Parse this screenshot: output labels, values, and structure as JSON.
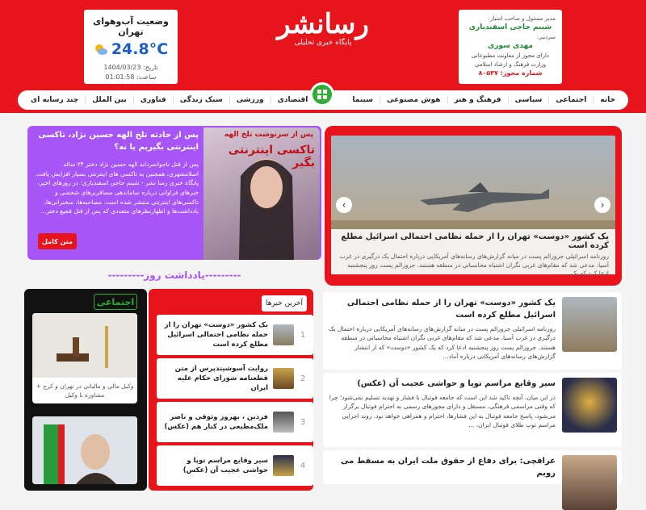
{
  "weather": {
    "title": "وضعیت آب‌وهوای تهران",
    "temp": "24.8°C",
    "date": "تاریخ: 1404/03/23",
    "time": "ساعت: 01:01:58"
  },
  "logo": {
    "wordmark": "رسانشر",
    "tagline": "پایگاه خبری تحلیلی"
  },
  "license": {
    "owner_label": "مدیر مسئول و صاحب امتیاز:",
    "owner_name": "شبنم حاجی اسفندیاری",
    "editor_label": "سردبیر:",
    "editor_name": "مهدی سوری",
    "license_text": "دارای مجوز از معاونت مطبوعاتی وزارت فرهنگ و ارشاد اسلامی",
    "license_no": "شماره مجوز: ۸۰۵۳۷"
  },
  "nav": {
    "right": [
      "خانه",
      "اجتماعی",
      "سیاسی",
      "فرهنگ و هنر",
      "هوش مصنوعی",
      "سینما"
    ],
    "left": [
      "اقتصادی",
      "ورزشی",
      "سبک زندگی",
      "فناوری",
      "بین الملل",
      "چند رسانه ای"
    ]
  },
  "slider": {
    "title": "یک کشور «دوست» تهران را از حمله نظامی احتمالی اسرائیل مطلع کرده است",
    "description": "روزنامه اسرائیلی جروزالم پست در میانه گزارش‌های رسانه‌های آمریکایی درباره احتمال یک درگیری در غرب آسیا، مدعی شد که مقام‌های غربی نگران اشتباه محاسباتی در منطقه هستند. جروزالم پست روز پنجشنبه ادعا کرد که یک..."
  },
  "feature": {
    "title": "پس از حادثه تلخ الهه حسین نژاد، تاکسی اینترنتی بگیریم یا نه؟",
    "description": "پس از قتل ناجوانمردانه الهه حسین نژاد دختر ۲۴ ساله اسلامشهری، همچنین به تاکسی های اینترنتی بسیار افزایش یافت. پایگاه خبری رسا نشر - شبنم حاجی اسفندیاری: در روزهای اخیر، خبرهای فراوانی درباره ساماندهی مسافربرهای شخصی و تاکسی‌های اینترنتی منتشر شده است. مصاحبه‌ها، سخنرانی‌ها، یادداشت‌ها و اظهارنظرهای متعددی که پس از قتل فجیع دختر...",
    "more_label": "متن کامل",
    "photo_caption": "تاکسی اینترنتی بگیر",
    "photo_kicker": "پس از سرنوشت تلخ الهه"
  },
  "memo": {
    "title": "---------یادداشت روز---------"
  },
  "social": {
    "tag": "اجتماعی",
    "cards": [
      {
        "caption": "وکیل مالی و مالیاتی در تهران و کرج + مشاوره با وکیل"
      },
      {
        "caption": ""
      }
    ]
  },
  "latest": {
    "tab": "آخرین خبرها",
    "items": [
      {
        "num": "1",
        "title": "یک کشور «دوست» تهران را از حمله نظامی احتمالی اسرائیل مطلع کرده است"
      },
      {
        "num": "2",
        "title": "روایت آسوشیتدپرس از متن قطعنامه شورای حکام علیه ایران"
      },
      {
        "num": "3",
        "title": "فردین ، بهروز وثوقی و ناصر ملک‌مطیعی در کنار هم (عکس)"
      },
      {
        "num": "4",
        "title": "سیر وقایع مراسم توپا و حواشی عجیب آن (عکس)"
      }
    ]
  },
  "main_news": [
    {
      "title": "یک کشور «دوست» تهران را از حمله نظامی احتمالی اسرائیل مطلع کرده است",
      "description": "روزنامه اسرائیلی جروزالم پست در میانه گزارش‌های رسانه‌های آمریکایی درباره احتمال یک درگیری در غرب آسیا، مدعی شد که مقام‌های غربی نگران اشتباه محاسباتی در منطقه هستند. جروزالم پست روز پنجشنبه ادعا کرد که یک کشور «دوست» که از انتشار گزارش‌های رسانه‌های آمریکایی درباره آماد..."
    },
    {
      "title": "سیر وقایع مراسم توپا و حواشی عجیب آن (عکس)",
      "description": "در این میان، آنچه تاکید شد این است که جامعه فوتبال با فشار و تهدید تسلیم نمی‌شود؛ چرا که وقتی مراسمی فرهنگی، مستقل و دارای مجوزهای رسمی به احترام فوتبال برگزار می‌شود، پاسخ جامعه فوتبال به این فشارها، احترام و همراهی خواهد بود. روند اجرایی مراسم توپ طلای فوتبال ایران، ..."
    },
    {
      "title": "عراقچی: برای دفاع از حقوق ملت ایران به مسقط می رویم",
      "description": ""
    }
  ]
}
